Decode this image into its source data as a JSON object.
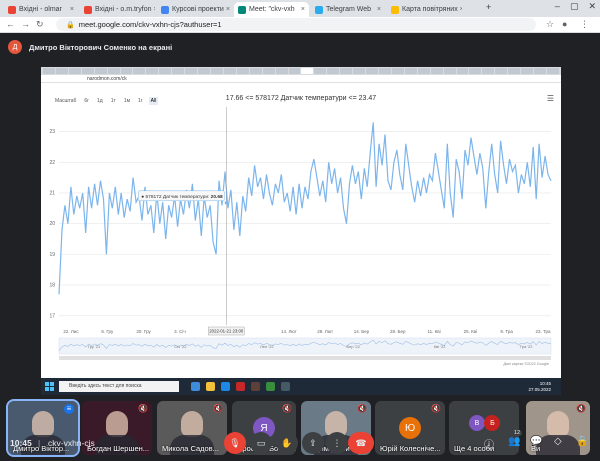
{
  "browser": {
    "tabs": [
      {
        "label": "Вхідні - olmar",
        "color": "#ea4335",
        "active": false
      },
      {
        "label": "Вхідні - o.m.tryfon",
        "color": "#ea4335",
        "active": false
      },
      {
        "label": "Курсові проекти",
        "color": "#4285f4",
        "active": false
      },
      {
        "label": "Meet: \"ckv-vxh",
        "color": "#00897b",
        "active": true
      },
      {
        "label": "Telegram Web",
        "color": "#2aabee",
        "active": false
      },
      {
        "label": "Карта повітряних",
        "color": "#fbbc04",
        "active": false
      }
    ],
    "new_tab": "+",
    "url": "meet.google.com/ckv-vxhn-cjs?authuser=1"
  },
  "presenter": {
    "initial": "Д",
    "label": "Дмитро Вікторович Соменко на екрані"
  },
  "shared_screen": {
    "inner_url": "narodmon.com/ck",
    "chart_title": "17.66 <= 578172 Датчик температури <= 23.47",
    "zoom_label": "Масштаб",
    "zoom_options": [
      "6г",
      "1д",
      "1т",
      "1м",
      "1г",
      "All"
    ],
    "zoom_selected": "All",
    "tooltip_prefix": "● 578172 Датчик температури: ",
    "tooltip_value": "20.68",
    "hover_label": "2022-01-21 23:00",
    "credits": "Дані картки ©2022 Google",
    "taskbar_search": "Введіть здесь текст для поиска",
    "taskbar_time": "10:45",
    "taskbar_date": "27.05.2022"
  },
  "chart_data": {
    "type": "line",
    "title": "17.66 <= 578172 Датчик температури <= 23.47",
    "y_ticks": [
      17,
      18,
      19,
      20,
      21,
      22,
      23
    ],
    "ylim": [
      16.7,
      23.8
    ],
    "x_ticks": [
      "22. Лис",
      "6. Гру",
      "20. Гру",
      "3. Січ",
      "17. Січ",
      "",
      "14. Лют",
      "28. Лют",
      "14. Бер",
      "28. Бер",
      "11. Кві",
      "25. Кві",
      "9. Тра",
      "23. Тра"
    ],
    "navigator_ticks": [
      "Гру '21",
      "Січ '22",
      "Лют '22",
      "Бер '22",
      "Кві '22",
      "Тра '22"
    ],
    "grid": true,
    "color": "#7cb5ec",
    "values": [
      17.7,
      19.8,
      20.6,
      20.0,
      21.2,
      20.3,
      20.9,
      20.5,
      21.0,
      19.7,
      21.2,
      20.5,
      21.3,
      20.6,
      21.4,
      20.8,
      19.0,
      21.0,
      20.5,
      21.2,
      20.3,
      21.0,
      20.2,
      20.8,
      20.4,
      21.5,
      20.7,
      20.9,
      20.1,
      21.2,
      20.3,
      20.6,
      19.7,
      21.0,
      20.0,
      20.7,
      19.5,
      20.6,
      20.2,
      20.9,
      19.9,
      20.8,
      20.3,
      21.1,
      20.5,
      21.3,
      20.1,
      20.8,
      19.6,
      20.9,
      20.2,
      20.6,
      19.4,
      19.0,
      21.4,
      20.6,
      21.7,
      20.5,
      21.1,
      19.8,
      20.7,
      19.6,
      20.9,
      20.4,
      21.5,
      20.9,
      21.9,
      21.2,
      21.5,
      20.8,
      21.6,
      21.0,
      20.6,
      21.3,
      21.0,
      21.6,
      20.7,
      21.0,
      20.4,
      21.2,
      20.3,
      21.3,
      20.5,
      21.2,
      20.8,
      21.7,
      22.1,
      21.5,
      20.9,
      21.4,
      20.7,
      22.0,
      21.3,
      21.8,
      21.0,
      21.5,
      20.5,
      20.0,
      21.3,
      21.9,
      21.3,
      21.7,
      20.8,
      21.8,
      21.2,
      22.3,
      23.3,
      21.2,
      22.6,
      21.9,
      22.9,
      21.4,
      21.1,
      22.0,
      22.4,
      21.6,
      21.1,
      22.6,
      21.9,
      21.2,
      20.7,
      21.4,
      20.9,
      21.5,
      21.0,
      21.6,
      21.4,
      22.3,
      21.7,
      21.1,
      20.5,
      22.6,
      21.0,
      20.2,
      22.1,
      21.7,
      20.8,
      22.4,
      21.9,
      22.8,
      22.2,
      21.6,
      22.3,
      21.8,
      20.5,
      21.7,
      22.6,
      21.6,
      21.0,
      22.7,
      21.9,
      21.3,
      22.1,
      21.7,
      21.9,
      21.0,
      21.6,
      21.3,
      22.0,
      21.2,
      22.5,
      20.8,
      22.6,
      21.5,
      22.2,
      21.6,
      21.4
    ]
  },
  "participants": [
    {
      "name": "Дмитро Віктор...",
      "initial": "",
      "type": "video",
      "bg": "#4a5a6e",
      "muted": false
    },
    {
      "name": "Богдан Шершен...",
      "initial": "",
      "type": "video",
      "bg": "#3a1a28",
      "muted": true
    },
    {
      "name": "Микола Садов...",
      "initial": "",
      "type": "video",
      "bg": "#5a5a5a",
      "muted": true
    },
    {
      "name": "Ярослав Бобей...",
      "initial": "Я",
      "type": "avatar",
      "bg": "#7e57c2",
      "muted": true
    },
    {
      "name": "Вадим Домич",
      "initial": "",
      "type": "video",
      "bg": "#6a7a86",
      "muted": true
    },
    {
      "name": "Юрій Колесніче...",
      "initial": "Ю",
      "type": "avatar",
      "bg": "#e8710a",
      "muted": true
    },
    {
      "name": "Ще 4 особи",
      "initial": "Б",
      "type": "group",
      "bg": "#c5221f",
      "muted": false
    },
    {
      "name": "Ви",
      "initial": "",
      "type": "video",
      "bg": "#a0958a",
      "muted": true
    }
  ],
  "group_extra_initial": "В",
  "bottom_bar": {
    "time": "10:45",
    "separator": "|",
    "meeting_code": "ckv-vxhn-cjs",
    "people_count": "12"
  },
  "icons": [
    "mic-off-icon",
    "camera-icon",
    "raise-hand-icon",
    "present-icon",
    "more-icon",
    "end-call-icon",
    "info-icon",
    "people-icon",
    "chat-icon",
    "activities-icon",
    "lock-icon"
  ]
}
